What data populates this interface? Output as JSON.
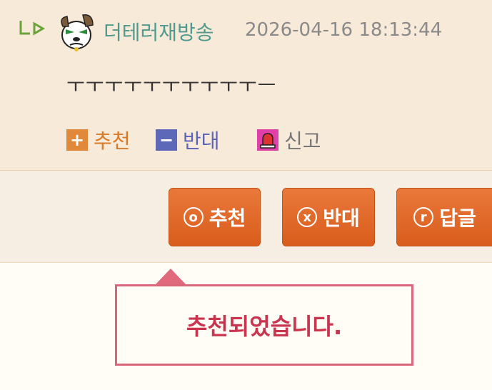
{
  "comment": {
    "nickname": "더테러재방송",
    "datetime": "2026-04-16 18:13:44",
    "content": "ㅜㅜㅜㅜㅜㅜㅜㅜㅜㅜㅡ",
    "vote_up_label": "추천",
    "vote_down_label": "반대",
    "report_label": "신고"
  },
  "actions": {
    "recommend_icon": "o",
    "recommend_label": "추천",
    "oppose_icon": "x",
    "oppose_label": "반대",
    "reply_icon": "r",
    "reply_label": "답글"
  },
  "tooltip": {
    "message": "추천되었습니다."
  },
  "colors": {
    "accent": "#e06a2c",
    "nickname": "#4e9a8e",
    "tooltip_border": "#d9667a",
    "tooltip_text": "#c9354e"
  }
}
